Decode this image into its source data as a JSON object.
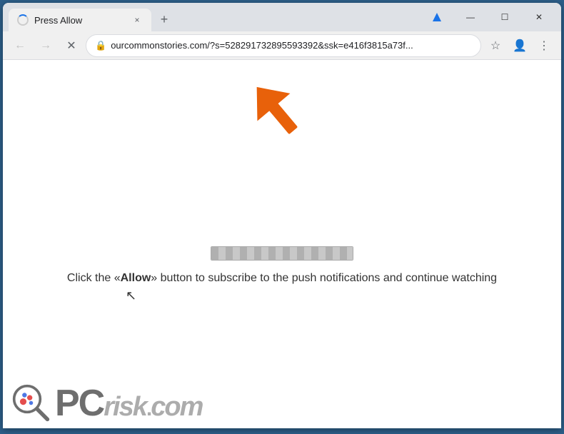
{
  "browser": {
    "title": "Press Allow",
    "tab": {
      "label": "Press Allow",
      "close_label": "×"
    },
    "new_tab_label": "+",
    "window_controls": {
      "minimize": "—",
      "maximize": "☐",
      "close": "✕"
    },
    "nav": {
      "back_label": "←",
      "forward_label": "→",
      "stop_label": "✕"
    },
    "address_bar": {
      "url": "ourcommonstories.com/?s=528291732895593392&ssk=e416f3815a73f...",
      "lock_icon": "🔒"
    },
    "toolbar_icons": {
      "bookmark_label": "☆",
      "profile_label": "👤",
      "menu_label": "⋮",
      "extension_label": "⬦"
    }
  },
  "page": {
    "instruction_text_prefix": "Click the «",
    "instruction_text_bold": "Allow",
    "instruction_text_suffix": "» button to subscribe to the push notifications and continue watching"
  },
  "watermark": {
    "pc_text": "PC",
    "risk_text": "risk",
    "dot_text": ".",
    "com_text": "com"
  }
}
